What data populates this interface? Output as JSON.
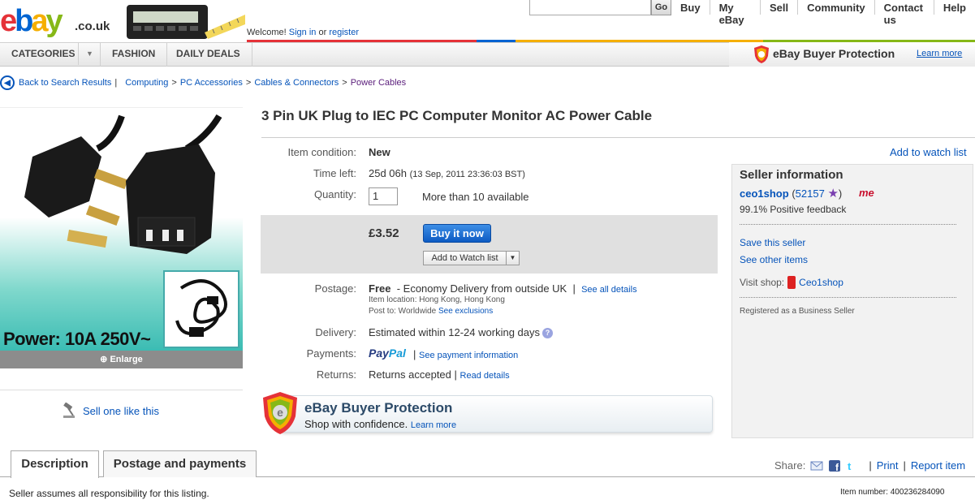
{
  "header": {
    "logo_text": "ebay",
    "logo_suffix": ".co.uk",
    "welcome_prefix": "Welcome!",
    "sign_in": "Sign in",
    "or": "or",
    "register": "register",
    "go_label": "Go",
    "nav": [
      "Buy",
      "My eBay",
      "Sell",
      "Community",
      "Contact us",
      "Help"
    ],
    "colors": [
      "#e53238",
      "#0064d2",
      "#f5af02",
      "#86b817"
    ]
  },
  "catbar": {
    "categories": "CATEGORIES",
    "fashion": "FASHION",
    "daily_deals": "DAILY DEALS",
    "buyer_protection": "eBay Buyer Protection",
    "learn_more": "Learn more"
  },
  "breadcrumb": {
    "back": "Back to Search Results",
    "items": [
      "Computing",
      "PC Accessories",
      "Cables & Connectors",
      "Power Cables"
    ]
  },
  "image": {
    "caption": "Power: 10A 250V~",
    "enlarge": "Enlarge",
    "sell_like": "Sell one like this"
  },
  "item": {
    "title": "3 Pin UK Plug to IEC PC Computer Monitor AC Power Cable",
    "condition_label": "Item condition:",
    "condition": "New",
    "time_label": "Time left:",
    "time": "25d 06h",
    "time_detail": "(13 Sep, 2011 23:36:03 BST)",
    "qty_label": "Quantity:",
    "qty_value": "1",
    "available": "More than 10 available",
    "price": "£3.52",
    "buy_now": "Buy it now",
    "add_watch": "Add to Watch list",
    "postage_label": "Postage:",
    "postage_free": "Free",
    "postage_desc": "- Economy Delivery from outside UK",
    "see_all": "See all details",
    "location": "Item location: Hong Kong, Hong Kong",
    "post_to": "Post to: Worldwide",
    "see_exclusions": "See exclusions",
    "delivery_label": "Delivery:",
    "delivery": "Estimated within 12-24 working days",
    "payments_label": "Payments:",
    "paypal_pay": "Pay",
    "paypal_pal": "Pal",
    "see_payment": "See payment information",
    "returns_label": "Returns:",
    "returns": "Returns accepted",
    "read_details": "Read details",
    "bp_title": "eBay Buyer Protection",
    "bp_sub": "Shop with confidence.",
    "bp_learn": "Learn more"
  },
  "seller": {
    "add_to_watch": "Add to watch list",
    "title": "Seller information",
    "name": "ceo1shop",
    "feedback_score": "52157",
    "me_badge": "me",
    "positive": "99.1% Positive feedback",
    "save": "Save this seller",
    "see_other": "See other items",
    "visit_label": "Visit shop:",
    "shop": "Ceo1shop",
    "registered": "Registered as a Business Seller"
  },
  "tabs": {
    "description": "Description",
    "postage": "Postage and payments",
    "share": "Share:",
    "print": "Print",
    "report": "Report item"
  },
  "footer": {
    "responsibility": "Seller assumes all responsibility for this listing.",
    "item_number": "Item number: 400236284090"
  }
}
